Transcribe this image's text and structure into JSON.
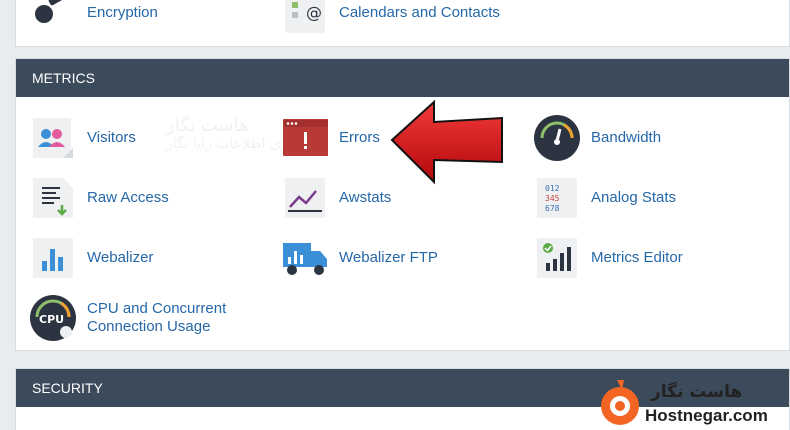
{
  "top_items": [
    {
      "label": "Encryption",
      "icon": "key-icon"
    },
    {
      "label": "Calendars and Contacts",
      "icon": "calendar-contacts-icon"
    }
  ],
  "metrics": {
    "title": "METRICS",
    "items": [
      {
        "label": "Visitors",
        "icon": "visitors-icon"
      },
      {
        "label": "Errors",
        "icon": "errors-icon"
      },
      {
        "label": "Bandwidth",
        "icon": "bandwidth-gauge-icon"
      },
      {
        "label": "Raw Access",
        "icon": "raw-access-icon"
      },
      {
        "label": "Awstats",
        "icon": "awstats-icon"
      },
      {
        "label": "Analog Stats",
        "icon": "analog-stats-icon"
      },
      {
        "label": "Webalizer",
        "icon": "webalizer-icon"
      },
      {
        "label": "Webalizer FTP",
        "icon": "webalizer-ftp-icon"
      },
      {
        "label": "Metrics Editor",
        "icon": "metrics-editor-icon"
      },
      {
        "label": "CPU and Concurrent Connection Usage",
        "icon": "cpu-usage-icon"
      }
    ],
    "cpu_label_line1": "CPU and Concurrent",
    "cpu_label_line2": "Connection Usage",
    "analog_digits": [
      "012",
      "345",
      "678"
    ],
    "cpu_text": "CPU"
  },
  "security": {
    "title": "SECURITY"
  },
  "watermark": {
    "fa_title": "هاست نگار",
    "fa_subtitle": "فناوری اطلاعات رایا نگار"
  },
  "logo": {
    "fa_text": "هاست نگار",
    "en_text": "Hostnegar.com"
  },
  "colors": {
    "header_bg": "#3c4b5c",
    "link": "#2568a8",
    "arrow": "#d7141a",
    "logo_orange": "#f26522"
  }
}
